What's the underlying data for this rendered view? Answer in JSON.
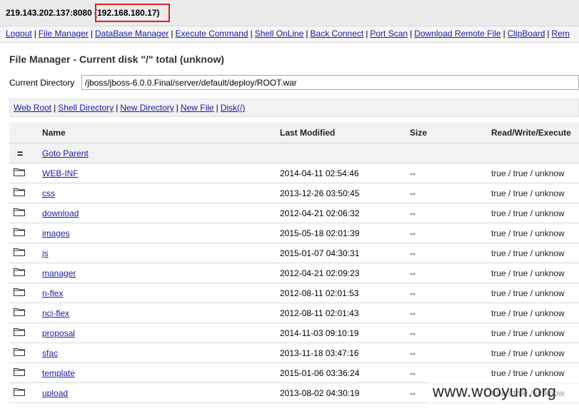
{
  "host": {
    "address": "219.143.202.137:8080",
    "internal_ip": "(192.168.180.17)"
  },
  "nav": [
    "Logout",
    "File Manager",
    "DataBase Manager",
    "Execute Command",
    "Shell OnLine",
    "Back Connect",
    "Port Scan",
    "Download Remote File",
    "ClipBoard",
    "Rem"
  ],
  "section_title": "File Manager - Current disk \"/\" total (unknow)",
  "current_directory": {
    "label": "Current Directory",
    "value": "/jboss/jboss-6.0.0.Final/server/default/deploy/ROOT.war"
  },
  "toolbar": [
    "Web Root",
    "Shell Directory",
    "New Directory",
    "New File",
    "Disk(/)"
  ],
  "table": {
    "headers": {
      "name": "Name",
      "modified": "Last Modified",
      "size": "Size",
      "rwx": "Read/Write/Execute"
    },
    "parent": {
      "icon": "=",
      "label": "Goto Parent"
    },
    "rows": [
      {
        "name": "WEB-INF",
        "modified": "2014-04-11 02:54:46",
        "size": "--",
        "rwx": "true / true / unknow"
      },
      {
        "name": "css",
        "modified": "2013-12-26 03:50:45",
        "size": "--",
        "rwx": "true / true / unknow"
      },
      {
        "name": "download",
        "modified": "2012-04-21 02:06:32",
        "size": "--",
        "rwx": "true / true / unknow"
      },
      {
        "name": "images",
        "modified": "2015-05-18 02:01:39",
        "size": "--",
        "rwx": "true / true / unknow"
      },
      {
        "name": "js",
        "modified": "2015-01-07 04:30:31",
        "size": "--",
        "rwx": "true / true / unknow"
      },
      {
        "name": "manager",
        "modified": "2012-04-21 02:09:23",
        "size": "--",
        "rwx": "true / true / unknow"
      },
      {
        "name": "n-flex",
        "modified": "2012-08-11 02:01:53",
        "size": "--",
        "rwx": "true / true / unknow"
      },
      {
        "name": "nci-flex",
        "modified": "2012-08-11 02:01:43",
        "size": "--",
        "rwx": "true / true / unknow"
      },
      {
        "name": "proposal",
        "modified": "2014-11-03 09:10:19",
        "size": "--",
        "rwx": "true / true / unknow"
      },
      {
        "name": "sfac",
        "modified": "2013-11-18 03:47:16",
        "size": "--",
        "rwx": "true / true / unknow"
      },
      {
        "name": "template",
        "modified": "2015-01-06 03:36:24",
        "size": "--",
        "rwx": "true / true / unknow"
      },
      {
        "name": "upload",
        "modified": "2013-08-02 04:30:19",
        "size": "--",
        "rwx": "true / true / unknow"
      }
    ]
  },
  "watermark": "www.wooyun.org",
  "icons": {
    "folder": "folder-icon",
    "parent": "parent-directory-icon"
  },
  "colors": {
    "link": "#1a1aa6",
    "highlight_box": "#e02020"
  }
}
